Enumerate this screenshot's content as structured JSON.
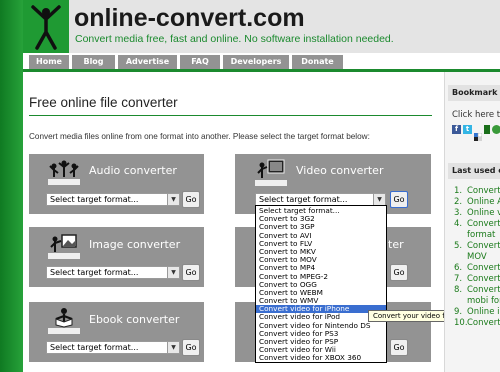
{
  "header": {
    "site_name": "online-convert.com",
    "tagline": "Convert media free, fast and online. No software installation needed."
  },
  "nav": [
    "Home",
    "Blog",
    "Advertise",
    "FAQ",
    "Developers",
    "Donate"
  ],
  "main": {
    "title": "Free online file converter",
    "intro": "Convert media files online from one format into another. Please select the target format below:",
    "panels": {
      "audio": {
        "title": "Audio converter",
        "select": "Select target format...",
        "go": "Go"
      },
      "video": {
        "title": "Video converter",
        "select": "Select target format...",
        "go": "Go"
      },
      "image": {
        "title": "Image converter",
        "select": "Select target format...",
        "go": "Go"
      },
      "image_right": {
        "title_fragment": "ter",
        "go": "Go"
      },
      "ebook": {
        "title": "Ebook converter",
        "select": "Select target format...",
        "go": "Go"
      },
      "ebook_right": {
        "go": "Go"
      }
    },
    "dropdown": {
      "options": [
        "Select target format...",
        "Convert to 3G2",
        "Convert to 3GP",
        "Convert to AVI",
        "Convert to FLV",
        "Convert to MKV",
        "Convert to MOV",
        "Convert to MP4",
        "Convert to MPEG-2",
        "Convert to OGG",
        "Convert to WEBM",
        "Convert to WMV",
        "Convert video for iPhone",
        "Convert video for iPod",
        "Convert video for Nintendo DS",
        "Convert video for PS3",
        "Convert video for PSP",
        "Convert video for Wii",
        "Convert video for XBOX 360"
      ],
      "highlighted_index": 12,
      "tooltip": "Convert your video for your iPhone"
    }
  },
  "sidebar": {
    "bookmark_title": "Bookmark an",
    "bookmark_text": "Click here to",
    "last_used_title": "Last used co",
    "last_used": [
      {
        "num": "1.",
        "text": "Convert"
      },
      {
        "num": "2.",
        "text": "Online A"
      },
      {
        "num": "3.",
        "text": "Online vi"
      },
      {
        "num": "4.",
        "text": "Convert"
      },
      {
        "num": "",
        "text": "format"
      },
      {
        "num": "5.",
        "text": "Convert"
      },
      {
        "num": "",
        "text": "MOV"
      },
      {
        "num": "6.",
        "text": "Convert"
      },
      {
        "num": "7.",
        "text": "Convert"
      },
      {
        "num": "8.",
        "text": "Convert"
      },
      {
        "num": "",
        "text": "mobi form"
      },
      {
        "num": "9.",
        "text": "Online im"
      },
      {
        "num": "10.",
        "text": "Convert"
      }
    ]
  },
  "colors": {
    "brand_green": "#1b8a2e",
    "header_bg": "#e6e6e6",
    "panel_gray": "#939393",
    "highlight_blue": "#3a6ed0"
  }
}
